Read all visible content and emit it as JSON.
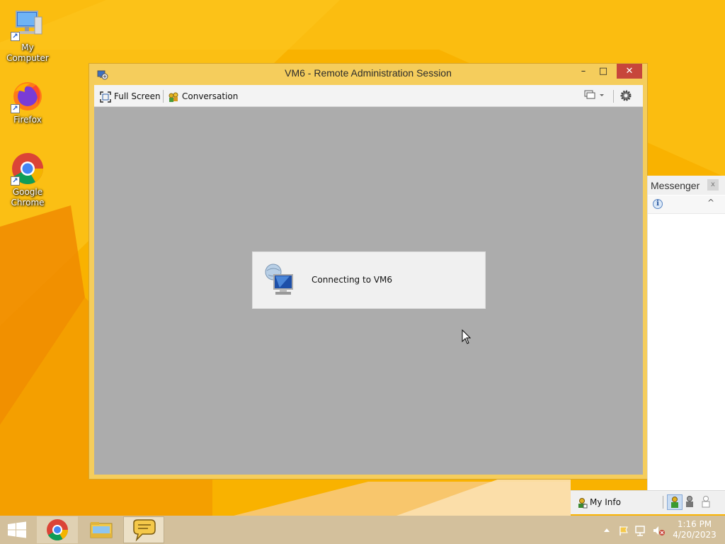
{
  "desktop": {
    "icons": [
      {
        "label": "My Computer",
        "icon": "computer-icon"
      },
      {
        "label": "Firefox",
        "icon": "firefox-icon"
      },
      {
        "label": "Google\nChrome",
        "icon": "chrome-icon"
      }
    ]
  },
  "window": {
    "title": "VM6 - Remote Administration Session",
    "minimize_glyph": "–",
    "maximize_glyph": "□",
    "close_glyph": "✕"
  },
  "toolbar": {
    "full_screen_label": "Full Screen",
    "conversation_label": "Conversation"
  },
  "session": {
    "status_text": "Connecting to VM6"
  },
  "messenger": {
    "title": "Messenger",
    "close_glyph": "x",
    "info_glyph": "i",
    "collapse_glyph": "^",
    "my_info_label": "My Info"
  },
  "taskbar": {
    "apps": [
      "chrome-icon",
      "file-explorer-icon",
      "messenger-icon"
    ],
    "time": "1:16 PM",
    "date": "4/20/2023"
  },
  "colors": {
    "wallpaper": "#f9b200",
    "window_frame": "#f5cd5c",
    "close_button": "#c7463b",
    "session_background": "#acacac",
    "taskbar": "#d3c09c"
  }
}
